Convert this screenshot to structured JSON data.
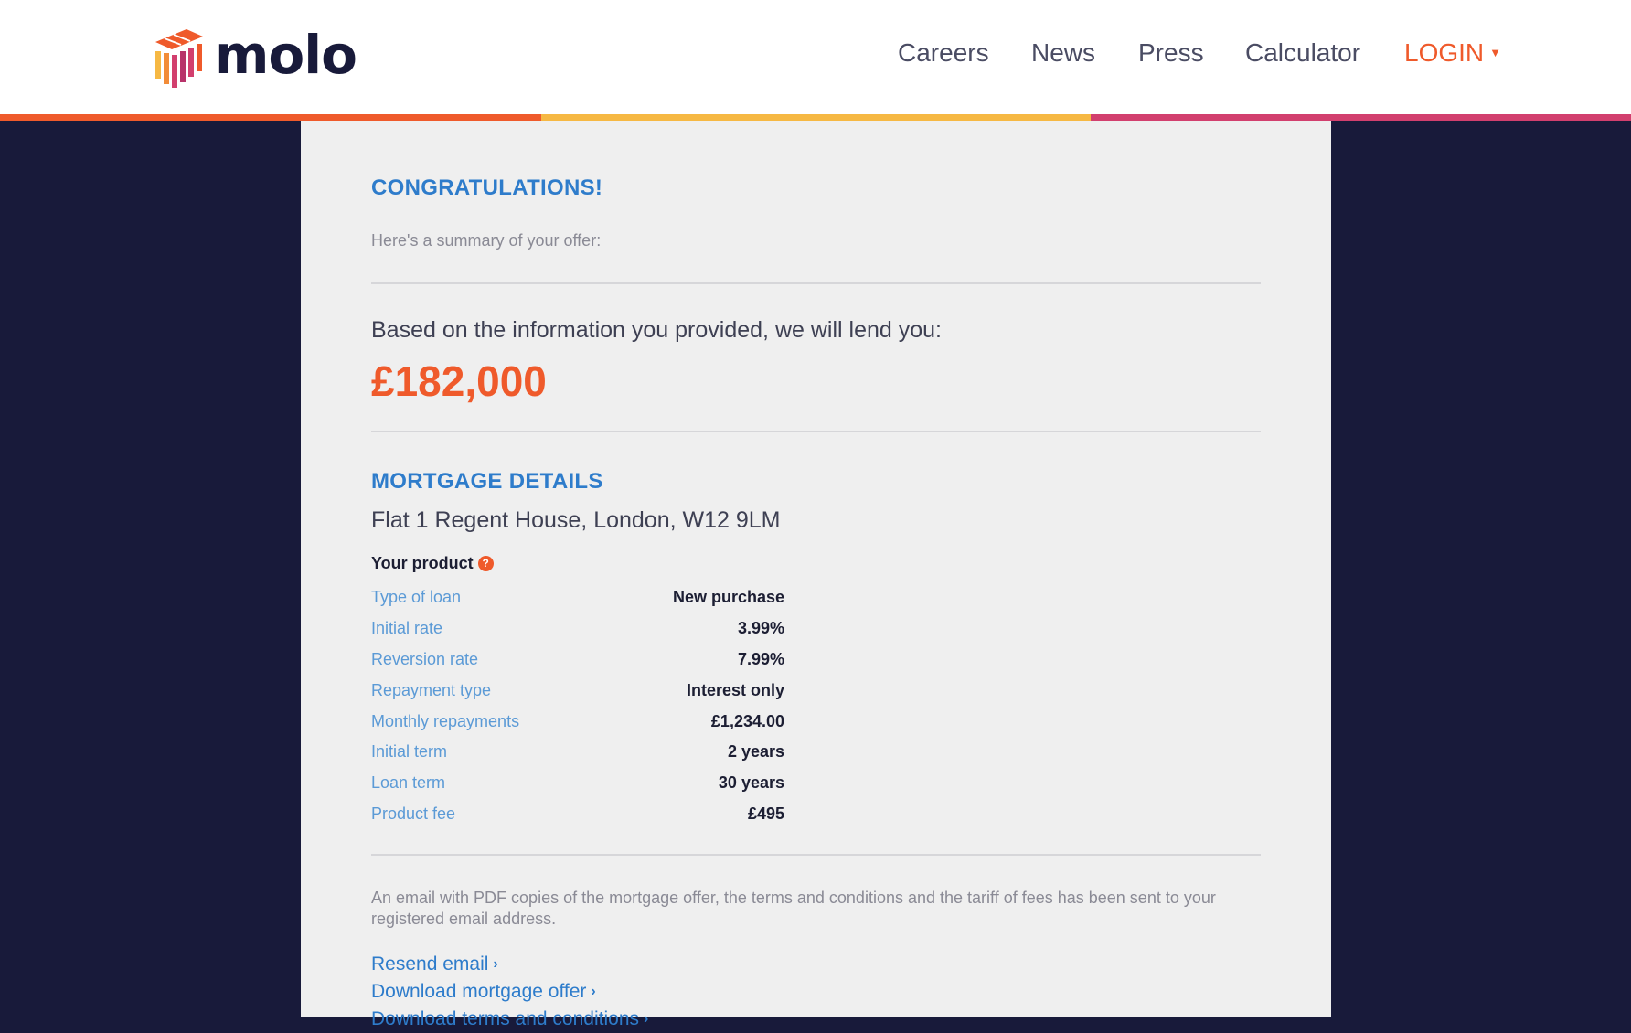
{
  "header": {
    "logo_text": "molo",
    "nav": {
      "careers": "Careers",
      "news": "News",
      "press": "Press",
      "calculator": "Calculator",
      "login": "LOGIN"
    }
  },
  "colors": {
    "navy": "#181a3a",
    "orange": "#ef5a2b",
    "yellow": "#f6b843",
    "pink": "#d23f6e",
    "blue": "#2e7ccb"
  },
  "offer": {
    "title": "CONGRATULATIONS!",
    "summary_text": "Here's a summary of your offer:",
    "lend_intro": "Based on the information you provided, we will lend you:",
    "amount": "£182,000"
  },
  "mortgage_details": {
    "heading": "MORTGAGE DETAILS",
    "address": "Flat 1 Regent House, London, W12 9LM",
    "product_heading": "Your product",
    "rows": [
      {
        "label": "Type of loan",
        "value": "New purchase"
      },
      {
        "label": "Initial rate",
        "value": "3.99%"
      },
      {
        "label": "Reversion rate",
        "value": "7.99%"
      },
      {
        "label": "Repayment type",
        "value": "Interest only"
      },
      {
        "label": "Monthly repayments",
        "value": "£1,234.00"
      },
      {
        "label": "Initial term",
        "value": "2 years"
      },
      {
        "label": "Loan term",
        "value": "30 years"
      },
      {
        "label": "Product fee",
        "value": "£495"
      }
    ]
  },
  "email_note": "An email with PDF copies of the mortgage offer, the terms and conditions and the tariff of fees has been sent to your registered email address.",
  "links": {
    "resend_email": "Resend email",
    "download_offer": "Download mortgage offer",
    "download_terms": "Download terms and conditions"
  }
}
